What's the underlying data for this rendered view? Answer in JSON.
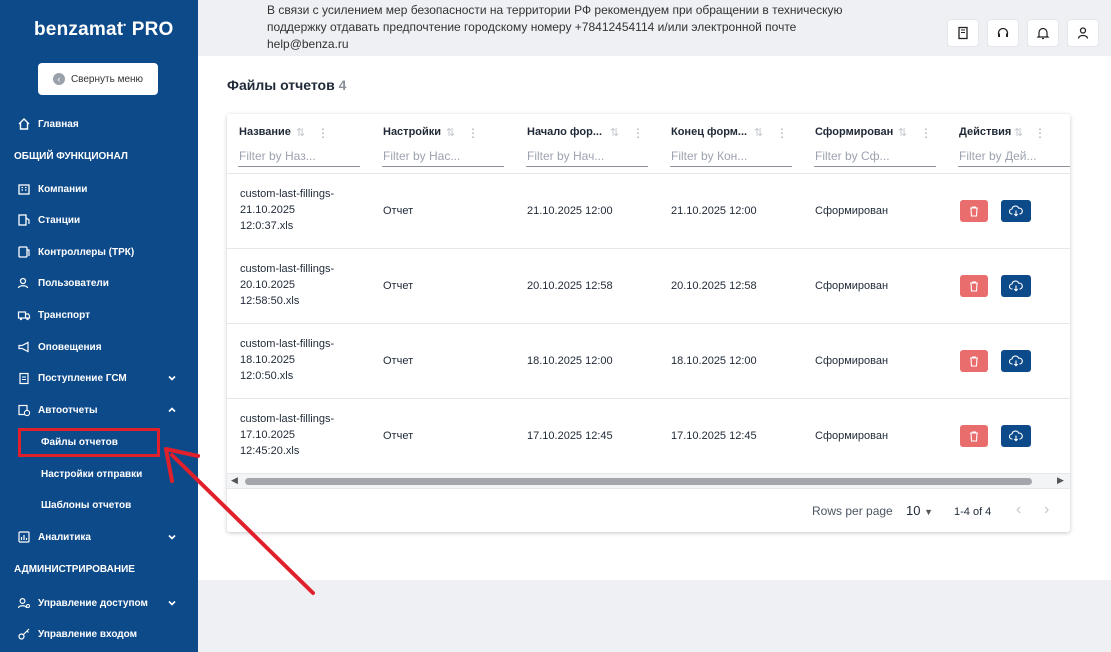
{
  "sidebar": {
    "brand": "benzamat",
    "brand_suffix": "PRO",
    "collapse_label": "Свернуть меню",
    "home": "Главная",
    "section_general": "ОБЩИЙ ФУНКЦИОНАЛ",
    "items": [
      {
        "label": "Компании",
        "icon": "building-icon"
      },
      {
        "label": "Станции",
        "icon": "fuel-station-icon"
      },
      {
        "label": "Контроллеры (ТРК)",
        "icon": "controller-icon"
      },
      {
        "label": "Пользователи",
        "icon": "users-icon"
      },
      {
        "label": "Транспорт",
        "icon": "truck-icon"
      },
      {
        "label": "Оповещения",
        "icon": "megaphone-icon"
      },
      {
        "label": "Поступление ГСМ",
        "icon": "clipboard-icon"
      },
      {
        "label": "Автоотчеты",
        "icon": "clock-report-icon"
      }
    ],
    "sub_items": [
      "Файлы отчетов",
      "Настройки отправки",
      "Шаблоны отчетов"
    ],
    "analytics": "Аналитика",
    "section_admin": "АДМИНИСТРИРОВАНИЕ",
    "access": "Управление доступом",
    "login": "Управление входом"
  },
  "topbar": {
    "notice": "В связи с усилением мер безопасности на территории РФ рекомендуем при обращении в техническую поддержку отдавать предпочтение городскому номеру +78412454114 и/или электронной почте help@benza.ru"
  },
  "page": {
    "title": "Файлы отчетов",
    "count": "4"
  },
  "grid": {
    "columns": [
      {
        "label": "Название",
        "filter": "Filter by Наз..."
      },
      {
        "label": "Настройки",
        "filter": "Filter by Нас..."
      },
      {
        "label": "Начало фор...",
        "filter": "Filter by Нач..."
      },
      {
        "label": "Конец форм...",
        "filter": "Filter by Кон..."
      },
      {
        "label": "Сформирован",
        "filter": "Filter by Сф..."
      },
      {
        "label": "Действия",
        "filter": "Filter by Дей..."
      }
    ],
    "rows": [
      {
        "name1": "custom-last-fillings-",
        "name2": "21.10.2025",
        "name3": "12:0:37.xls",
        "settings": "Отчет",
        "start": "21.10.2025 12:00",
        "end": "21.10.2025 12:00",
        "status": "Сформирован"
      },
      {
        "name1": "custom-last-fillings-",
        "name2": "20.10.2025",
        "name3": "12:58:50.xls",
        "settings": "Отчет",
        "start": "20.10.2025 12:58",
        "end": "20.10.2025 12:58",
        "status": "Сформирован"
      },
      {
        "name1": "custom-last-fillings-",
        "name2": "18.10.2025",
        "name3": "12:0:50.xls",
        "settings": "Отчет",
        "start": "18.10.2025 12:00",
        "end": "18.10.2025 12:00",
        "status": "Сформирован"
      },
      {
        "name1": "custom-last-fillings-",
        "name2": "17.10.2025",
        "name3": "12:45:20.xls",
        "settings": "Отчет",
        "start": "17.10.2025 12:45",
        "end": "17.10.2025 12:45",
        "status": "Сформирован"
      }
    ],
    "footer": {
      "rows_per_page_label": "Rows per page",
      "rows_per_page_value": "10",
      "range": "1-4 of 4"
    }
  },
  "colors": {
    "sidebar_bg": "#0d4a8a",
    "delete_btn": "#ea6d6d",
    "download_btn": "#0d4a8a",
    "highlight": "#e0212b"
  }
}
